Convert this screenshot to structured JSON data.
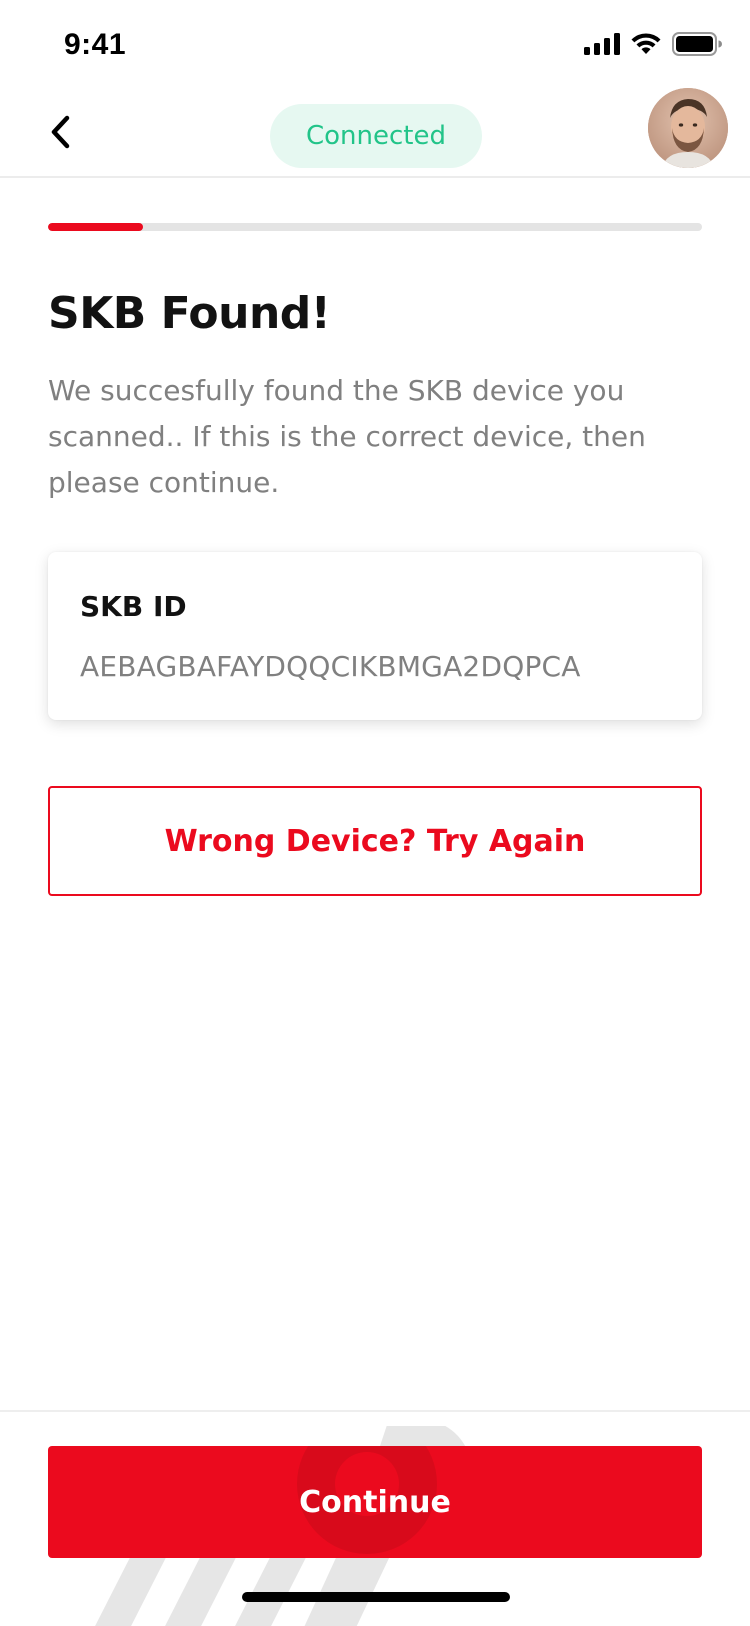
{
  "status_bar": {
    "time": "9:41",
    "icons": [
      "cellular-signal-icon",
      "wifi-icon",
      "battery-icon"
    ]
  },
  "header": {
    "back_icon": "chevron-left-icon",
    "status_label": "Connected",
    "avatar_icon": "user-avatar"
  },
  "progress": {
    "value": 0.145
  },
  "main": {
    "title": "SKB Found!",
    "description": "We succesfully found the SKB device you scanned.. If this is the correct device, then please continue.",
    "card": {
      "label": "SKB ID",
      "value": "AEBAGBAFAYDQQCIKBMGA2DQPCA"
    },
    "retry_label": "Wrong Device? Try Again"
  },
  "footer": {
    "continue_label": "Continue"
  },
  "colors": {
    "brand_red": "#eb0a1e",
    "success_green": "#22c489",
    "success_bg": "#e6f8f1",
    "muted_text": "#808080",
    "heading_text": "#121212"
  }
}
